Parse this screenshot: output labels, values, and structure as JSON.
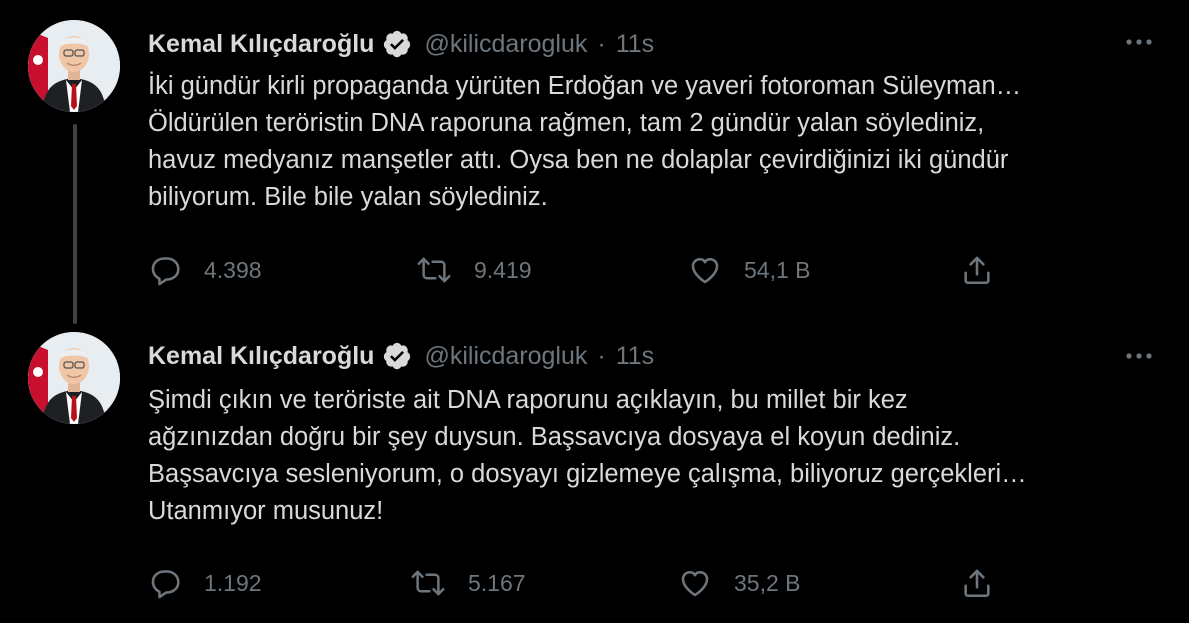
{
  "thread": {
    "tweets": [
      {
        "author": {
          "name": "Kemal Kılıçdaroğlu",
          "handle": "@kilicdarogluk",
          "separator": "·",
          "time": "11s",
          "verified": true
        },
        "text_lines": [
          "İki gündür kirli propaganda yürüten Erdoğan ve yaveri fotoroman Süleyman…",
          "Öldürülen teröristin DNA raporuna rağmen, tam 2 gündür yalan söylediniz,",
          "havuz medyanız manşetler attı. Oysa ben ne dolaplar çevirdiğinizi iki gündür",
          "biliyorum. Bile bile yalan söylediniz."
        ],
        "stats": {
          "replies": "4.398",
          "retweets": "9.419",
          "likes": "54,1 B"
        }
      },
      {
        "author": {
          "name": "Kemal Kılıçdaroğlu",
          "handle": "@kilicdarogluk",
          "separator": "·",
          "time": "11s",
          "verified": true
        },
        "text_lines": [
          "Şimdi çıkın ve teröriste ait DNA raporunu açıklayın, bu millet bir kez",
          "ağzınızdan doğru bir şey duysun. Başsavcıya dosyaya el koyun dediniz.",
          "Başsavcıya sesleniyorum, o dosyayı gizlemeye çalışma, biliyoruz gerçekleri…",
          "Utanmıyor musunuz!"
        ],
        "stats": {
          "replies": "1.192",
          "retweets": "5.167",
          "likes": "35,2 B"
        }
      }
    ]
  },
  "theme": {
    "background": "#000000",
    "text_primary": "#d9d9d9",
    "text_secondary": "#6e767d",
    "verified_badge": "#d9d9d9",
    "thread_line": "#3d4144"
  },
  "icons": {
    "verified": "verified-badge-icon",
    "more": "more-options-icon",
    "reply": "reply-icon",
    "retweet": "retweet-icon",
    "like": "heart-icon",
    "share": "share-icon"
  }
}
